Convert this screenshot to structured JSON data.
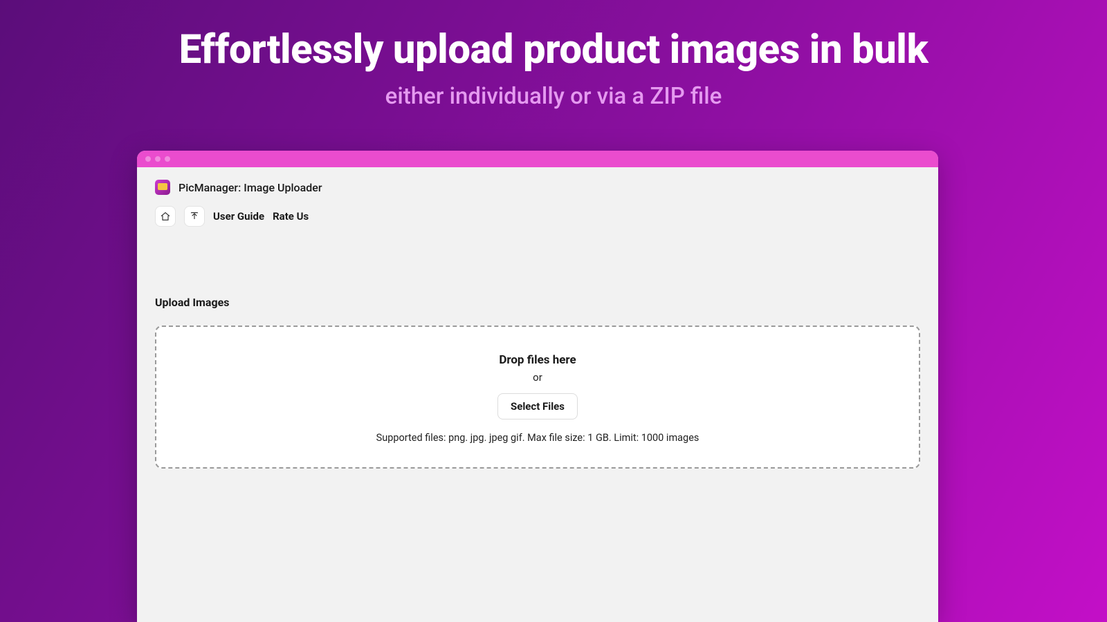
{
  "hero": {
    "title": "Effortlessly upload product images in bulk",
    "subtitle": "either individually or via a ZIP file"
  },
  "app": {
    "title": "PicManager: Image Uploader"
  },
  "nav": {
    "user_guide": "User Guide",
    "rate_us": "Rate Us"
  },
  "upload": {
    "section_title": "Upload Images",
    "drop_title": "Drop files here",
    "or": "or",
    "select_button": "Select Files",
    "help": "Supported files: png. jpg. jpeg gif. Max file size: 1 GB. Limit: 1000 images"
  },
  "colors": {
    "accent": "#ea4cce",
    "bg_gradient_from": "#5b0d7a",
    "bg_gradient_to": "#c30fc7"
  }
}
